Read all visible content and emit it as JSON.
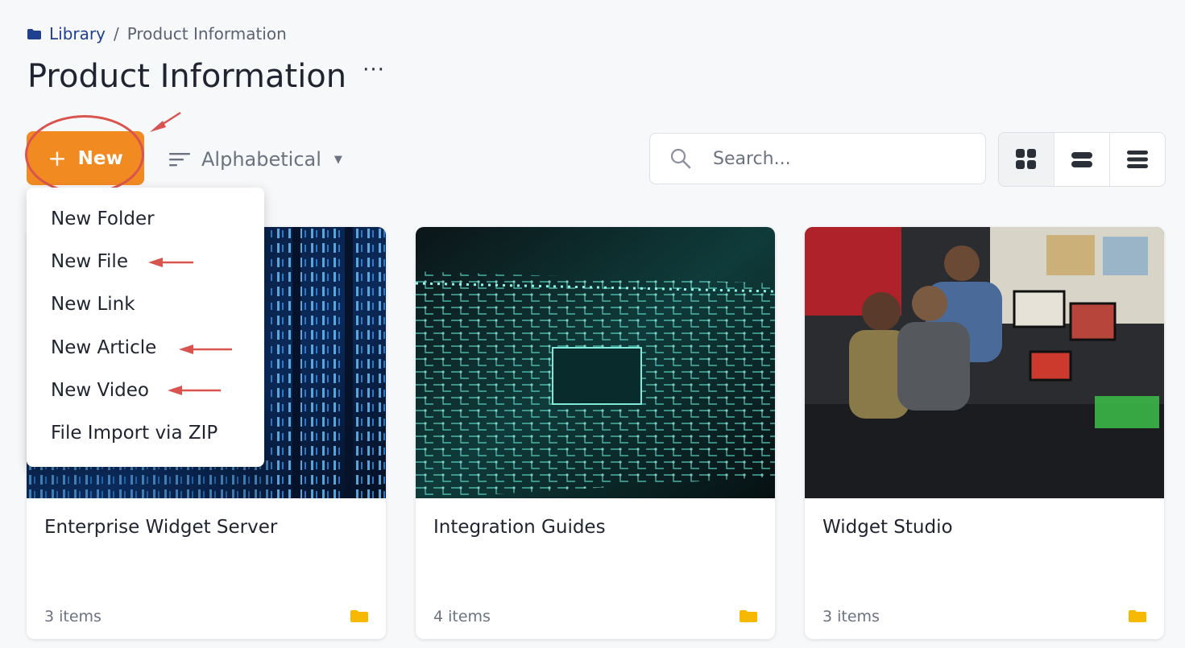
{
  "breadcrumb": {
    "root": "Library",
    "separator": "/",
    "current": "Product Information"
  },
  "page": {
    "title": "Product Information",
    "more_icon": "···"
  },
  "toolbar": {
    "new_button": {
      "icon": "+",
      "label": "New"
    },
    "sort": {
      "label": "Alphabetical"
    },
    "search": {
      "placeholder": "Search..."
    },
    "view_modes": [
      "grid-view-icon",
      "card-list-view-icon",
      "list-view-icon"
    ]
  },
  "new_menu": {
    "items": [
      "New Folder",
      "New File",
      "New Link",
      "New Article",
      "New Video",
      "File Import via ZIP"
    ]
  },
  "cards": [
    {
      "name": "Enterprise Widget Server",
      "count": "3 items"
    },
    {
      "name": "Integration Guides",
      "count": "4 items"
    },
    {
      "name": "Widget Studio",
      "count": "3 items"
    }
  ],
  "colors": {
    "accent": "#f28a22",
    "annotation": "#d9534f",
    "folder": "#f6b800",
    "link": "#1f3f8f"
  }
}
